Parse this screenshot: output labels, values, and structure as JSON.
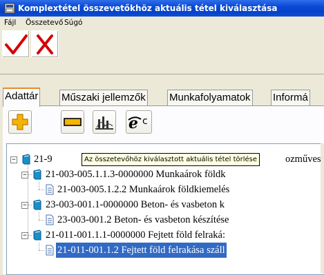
{
  "window": {
    "title": "Komplextétel összevetőkhöz aktuális tétel kiválasztása"
  },
  "menu": [
    "Fájl",
    "Összetevő",
    "Súgó"
  ],
  "toolbar": {
    "ok_icon": "checkmark-icon",
    "cancel_icon": "red-x-icon"
  },
  "tabs": [
    "Adattár",
    "Műszaki jellemzők",
    "Munkafolyamatok",
    "Informá"
  ],
  "subtoolbar": {
    "buttons": [
      "add-icon",
      "delete-icon",
      "chart-icon",
      "ie-icon"
    ],
    "ie_suffix": "c"
  },
  "tooltip": "Az összetevőhöz kiválasztott aktuális tétel törlése",
  "tree": [
    {
      "text": "21-9",
      "trailing": "ozműves",
      "level": 0,
      "type": "book",
      "toggle": "−"
    },
    {
      "text": "21-003-005.1.1.3-0000000 Munkaárok földk",
      "level": 1,
      "type": "book",
      "toggle": "−"
    },
    {
      "text": "21-003-005.1.2.2 Munkaárok földkiemelés",
      "level": 2,
      "type": "doc"
    },
    {
      "text": "23-003-001.1-0000000 Beton- és vasbeton k",
      "level": 1,
      "type": "book",
      "toggle": "−"
    },
    {
      "text": "23-003-001.2 Beton- és vasbeton készítése",
      "level": 2,
      "type": "doc"
    },
    {
      "text": "21-011-001.1.1-0000000 Fejtett föld felraká:",
      "level": 1,
      "type": "book",
      "toggle": "−"
    },
    {
      "text": "21-011-001.1.2 Fejtett föld felrakása száll",
      "level": 2,
      "type": "doc",
      "selected": true
    }
  ],
  "colors": {
    "titlebar": "#0a49d6",
    "selection": "#316ac5",
    "red": "#d40000",
    "tab_highlight": "#e68b2c"
  }
}
